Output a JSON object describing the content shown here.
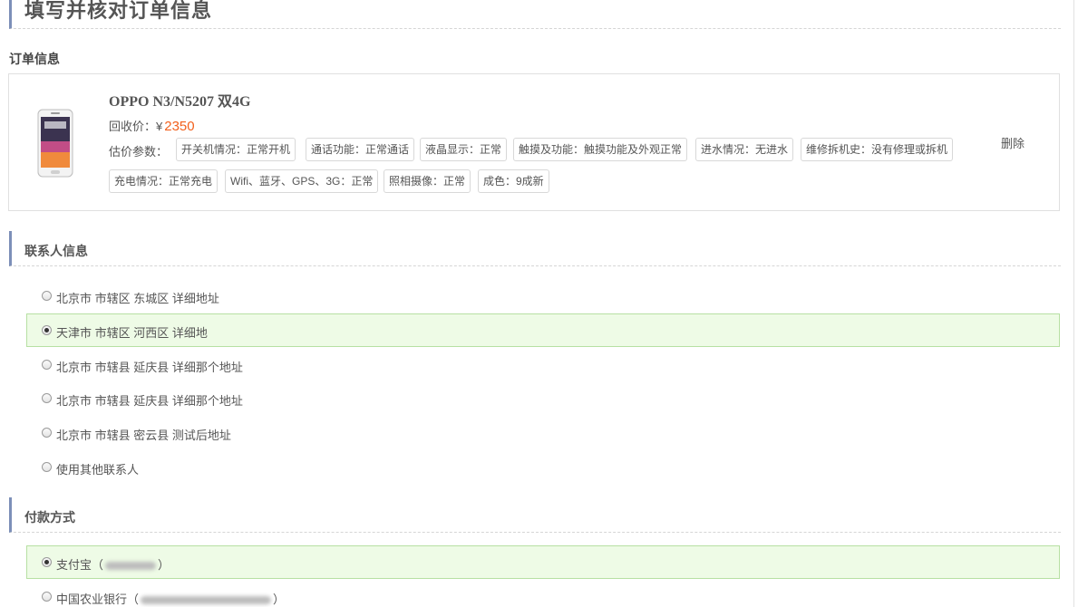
{
  "page": {
    "title": "填写并核对订单信息"
  },
  "order": {
    "section_title": "订单信息",
    "product_name": "OPPO N3/N5207 双4G",
    "price_label": "回收价：¥",
    "price_value": "2350",
    "params_label": "估价参数：",
    "params": [
      "开关机情况：正常开机",
      "通话功能：正常通话",
      "液晶显示：正常",
      "触摸及功能：触摸功能及外观正常",
      "进水情况：无进水",
      "维修拆机史：没有修理或拆机",
      "充电情况：正常充电",
      "Wifi、蓝牙、GPS、3G：正常",
      "照相摄像：正常",
      "成色：9成新"
    ],
    "delete_label": "删除",
    "phone_icon": "phone-product-image"
  },
  "contact": {
    "section_title": "联系人信息",
    "options": [
      {
        "label": "北京市 市辖区 东城区 详细地址",
        "selected": false
      },
      {
        "label": "天津市 市辖区 河西区 详细地",
        "selected": true
      },
      {
        "label": "北京市 市辖县 延庆县 详细那个地址",
        "selected": false
      },
      {
        "label": "北京市 市辖县 延庆县 详细那个地址",
        "selected": false
      },
      {
        "label": "北京市 市辖县 密云县 测试后地址",
        "selected": false
      },
      {
        "label": "使用其他联系人",
        "selected": false
      }
    ]
  },
  "payment": {
    "section_title": "付款方式",
    "options": [
      {
        "name": "支付宝",
        "open": "（",
        "close": "）",
        "selected": true
      },
      {
        "name": "中国农业银行",
        "open": "（",
        "close": "）",
        "selected": false
      }
    ]
  },
  "colors": {
    "accent": "#7c8fb8",
    "price": "#f2601c",
    "selected_bg": "#eefbe6",
    "selected_border": "#b7e0a3"
  }
}
